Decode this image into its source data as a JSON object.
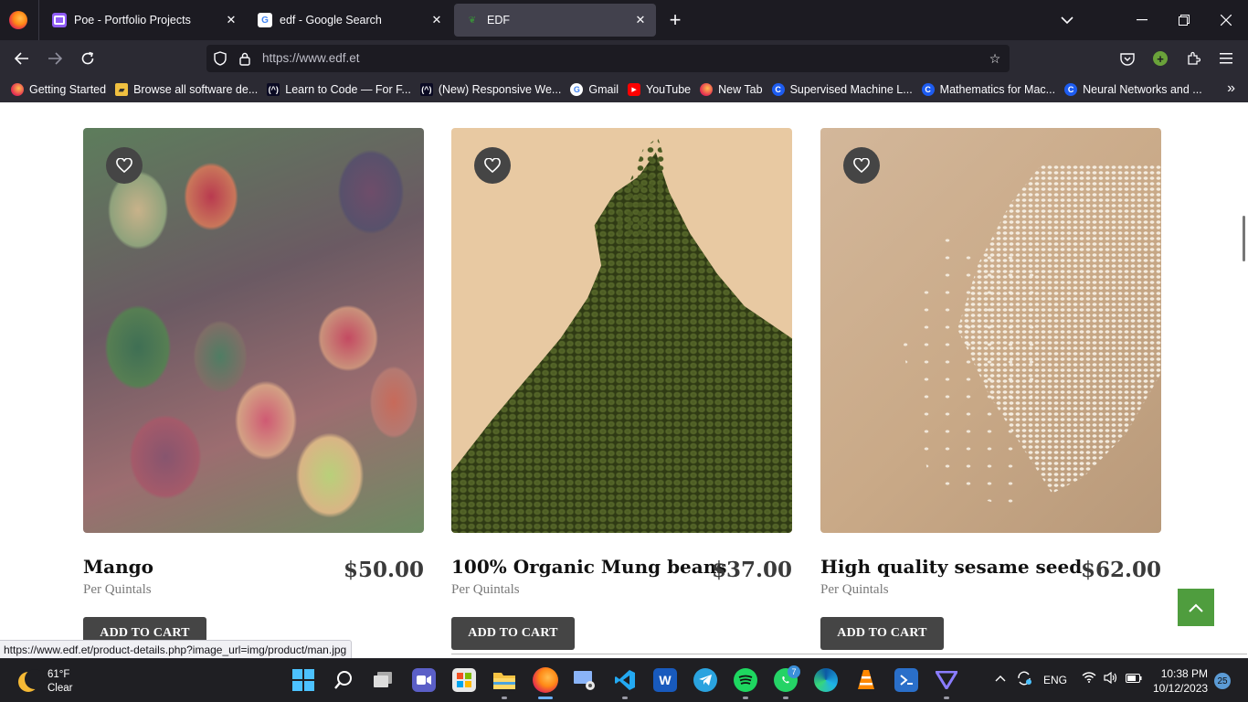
{
  "tabs": [
    {
      "title": "Poe - Portfolio Projects",
      "active": false
    },
    {
      "title": "edf - Google Search",
      "active": false
    },
    {
      "title": "EDF",
      "active": true
    }
  ],
  "navbar": {
    "url": "https://www.edf.et"
  },
  "bookmarks": [
    {
      "label": "Getting Started",
      "icon": "firefox-icon"
    },
    {
      "label": "Browse all software de...",
      "icon": "software-icon"
    },
    {
      "label": "Learn to Code — For F...",
      "icon": "freecodecamp-icon"
    },
    {
      "label": "(New) Responsive We...",
      "icon": "freecodecamp-icon"
    },
    {
      "label": "Gmail",
      "icon": "google-icon"
    },
    {
      "label": "YouTube",
      "icon": "youtube-icon"
    },
    {
      "label": "New Tab",
      "icon": "firefox-icon"
    },
    {
      "label": "Supervised Machine L...",
      "icon": "coursera-icon"
    },
    {
      "label": "Mathematics for Mac...",
      "icon": "coursera-icon"
    },
    {
      "label": "Neural Networks and ...",
      "icon": "coursera-icon"
    }
  ],
  "products": [
    {
      "name": "Mango",
      "price": "$50.00",
      "unit": "Per Quintals",
      "cart_label": "ADD TO CART"
    },
    {
      "name": "100% Organic Mung beans",
      "price": "$37.00",
      "unit": "Per Quintals",
      "cart_label": "ADD TO CART"
    },
    {
      "name": "High quality sesame seed",
      "price": "$62.00",
      "unit": "Per Quintals",
      "cart_label": "ADD TO CART"
    }
  ],
  "status_bar": {
    "link_url": "https://www.edf.et/product-details.php?image_url=img/product/man.jpg"
  },
  "taskbar": {
    "temperature": "61°F",
    "condition": "Clear",
    "whatsapp_badge": "7",
    "language": "ENG",
    "time": "10:38 PM",
    "date": "10/12/2023",
    "notification_count": "25"
  },
  "colors": {
    "accent_green": "#4f9d3e",
    "button_dark": "#454545",
    "browser_bg": "#1c1b22"
  }
}
